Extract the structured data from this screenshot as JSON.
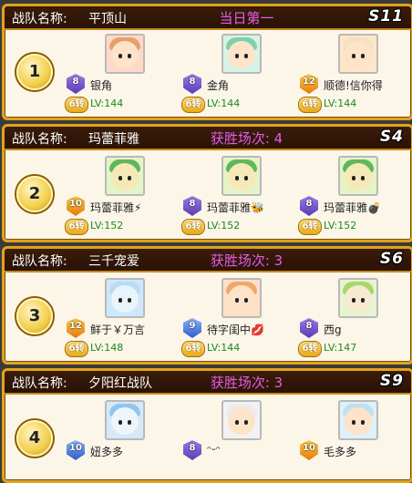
{
  "labels": {
    "team_name_label": "战队名称:"
  },
  "teams": [
    {
      "rank": "1",
      "name": "平顶山",
      "status": "当日第一",
      "season": "S11",
      "players": [
        {
          "name": "银角",
          "badge": "8",
          "badge_color": "purple",
          "tag": "6转",
          "level": "LV:144",
          "hair": "#e8a06a",
          "skin": "#fde3c8"
        },
        {
          "name": "金角",
          "badge": "8",
          "badge_color": "purple",
          "tag": "6转",
          "level": "LV:144",
          "hair": "#7fd0a8",
          "skin": "#fde3c8"
        },
        {
          "name": "顺德!信你得",
          "badge": "12",
          "badge_color": "orange",
          "tag": "6转",
          "level": "LV:144",
          "hair": "#f3e2c2",
          "skin": "#fde3c8"
        }
      ]
    },
    {
      "rank": "2",
      "name": "玛蕾菲雅",
      "status": "获胜场次: 4",
      "season": "S4",
      "players": [
        {
          "name": "玛蕾菲雅⚡",
          "badge": "10",
          "badge_color": "orange",
          "tag": "6转",
          "level": "LV:152",
          "hair": "#5fb85a",
          "skin": "#f6e9b8"
        },
        {
          "name": "玛蕾菲雅🐝",
          "badge": "8",
          "badge_color": "purple",
          "tag": "6转",
          "level": "LV:152",
          "hair": "#5fb85a",
          "skin": "#f6e9b8"
        },
        {
          "name": "玛蕾菲雅💣",
          "badge": "8",
          "badge_color": "purple",
          "tag": "6转",
          "level": "LV:152",
          "hair": "#5fb85a",
          "skin": "#f6e9b8"
        }
      ]
    },
    {
      "rank": "3",
      "name": "三千宠爱",
      "status": "获胜场次: 3",
      "season": "S6",
      "players": [
        {
          "name": "鲜于￥万言",
          "badge": "12",
          "badge_color": "orange",
          "tag": "6转",
          "level": "LV:148",
          "hair": "#b8dcf5",
          "skin": "#eaf4fb"
        },
        {
          "name": "待字闺中💋",
          "badge": "9",
          "badge_color": "blue",
          "tag": "6转",
          "level": "LV:144",
          "hair": "#f1a86a",
          "skin": "#fde3c8"
        },
        {
          "name": "西g",
          "badge": "8",
          "badge_color": "purple",
          "tag": "6转",
          "level": "LV:147",
          "hair": "#a6d86b",
          "skin": "#f6ead0"
        }
      ]
    },
    {
      "rank": "4",
      "name": "夕阳红战队",
      "status": "获胜场次: 3",
      "season": "S9",
      "players": [
        {
          "name": "妞多多",
          "badge": "10",
          "badge_color": "blue",
          "tag": "",
          "level": "",
          "hair": "#8fc6ee",
          "skin": "#eef6fb"
        },
        {
          "name": "ᵔᵕᵔ",
          "badge": "8",
          "badge_color": "purple",
          "tag": "",
          "level": "",
          "hair": "#ececec",
          "skin": "#fde3c8"
        },
        {
          "name": "毛多多",
          "badge": "10",
          "badge_color": "orange",
          "tag": "",
          "level": "",
          "hair": "#bfe0ef",
          "skin": "#fde3c8"
        }
      ]
    }
  ]
}
